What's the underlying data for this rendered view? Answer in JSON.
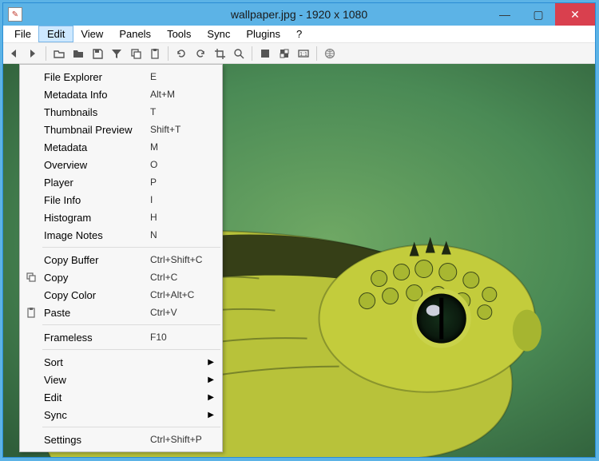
{
  "titlebar": {
    "title": "wallpaper.jpg  -  1920 x 1080"
  },
  "menubar": {
    "items": [
      "File",
      "Edit",
      "View",
      "Panels",
      "Tools",
      "Sync",
      "Plugins",
      "?"
    ],
    "open_index": 1
  },
  "toolbar": {
    "icons": [
      "nav-back",
      "nav-forward",
      "SEP",
      "folder-open",
      "folder",
      "save",
      "filter",
      "copy",
      "paste",
      "SEP",
      "rotate-ccw",
      "rotate-cw",
      "crop",
      "zoom",
      "SEP",
      "fill",
      "checker",
      "one-to-one",
      "SEP",
      "globe"
    ]
  },
  "dropdown": {
    "sections": [
      [
        {
          "label": "File Explorer",
          "shortcut": "E"
        },
        {
          "label": "Metadata Info",
          "shortcut": "Alt+M"
        },
        {
          "label": "Thumbnails",
          "shortcut": "T"
        },
        {
          "label": "Thumbnail Preview",
          "shortcut": "Shift+T"
        },
        {
          "label": "Metadata",
          "shortcut": "M"
        },
        {
          "label": "Overview",
          "shortcut": "O"
        },
        {
          "label": "Player",
          "shortcut": "P"
        },
        {
          "label": "File Info",
          "shortcut": "I"
        },
        {
          "label": "Histogram",
          "shortcut": "H"
        },
        {
          "label": "Image Notes",
          "shortcut": "N"
        }
      ],
      [
        {
          "label": "Copy Buffer",
          "shortcut": "Ctrl+Shift+C"
        },
        {
          "label": "Copy",
          "shortcut": "Ctrl+C",
          "icon": "copy"
        },
        {
          "label": "Copy Color",
          "shortcut": "Ctrl+Alt+C"
        },
        {
          "label": "Paste",
          "shortcut": "Ctrl+V",
          "icon": "paste"
        }
      ],
      [
        {
          "label": "Frameless",
          "shortcut": "F10"
        }
      ],
      [
        {
          "label": "Sort",
          "submenu": true
        },
        {
          "label": "View",
          "submenu": true
        },
        {
          "label": "Edit",
          "submenu": true
        },
        {
          "label": "Sync",
          "submenu": true
        }
      ],
      [
        {
          "label": "Settings",
          "shortcut": "Ctrl+Shift+P"
        }
      ]
    ]
  }
}
